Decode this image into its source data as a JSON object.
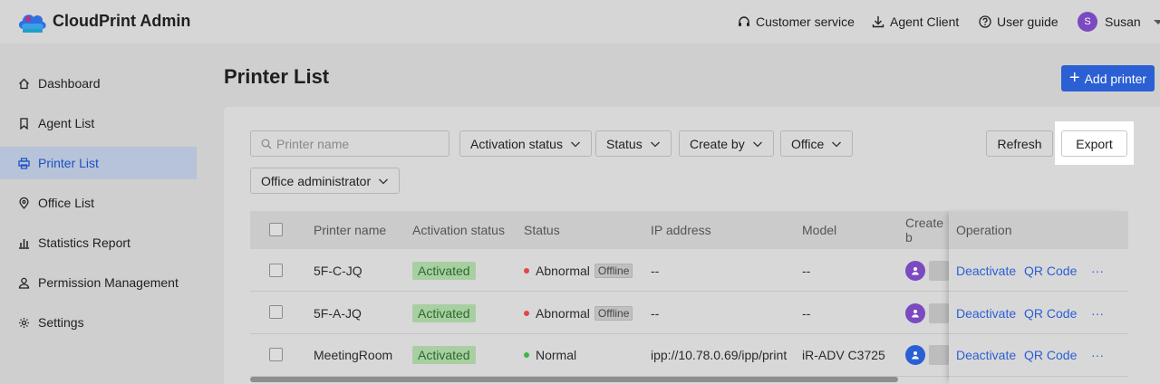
{
  "header": {
    "brand": "CloudPrint Admin",
    "customer_service": "Customer service",
    "agent_client": "Agent Client",
    "user_guide": "User guide",
    "user_initial": "S",
    "user_name": "Susan"
  },
  "sidebar": {
    "items": [
      {
        "label": "Dashboard",
        "icon": "home-icon"
      },
      {
        "label": "Agent List",
        "icon": "bookmark-icon"
      },
      {
        "label": "Printer List",
        "icon": "printer-icon",
        "active": true
      },
      {
        "label": "Office List",
        "icon": "location-icon"
      },
      {
        "label": "Statistics Report",
        "icon": "bar-chart-icon"
      },
      {
        "label": "Permission Management",
        "icon": "user-icon"
      },
      {
        "label": "Settings",
        "icon": "gear-icon"
      }
    ]
  },
  "main": {
    "title": "Printer List",
    "add_button": "Add printer",
    "search_placeholder": "Printer name",
    "filters": {
      "activation_status": "Activation status",
      "status": "Status",
      "create_by": "Create by",
      "office": "Office",
      "office_administrator": "Office administrator"
    },
    "refresh_button": "Refresh",
    "export_button": "Export"
  },
  "table": {
    "columns": {
      "printer_name": "Printer name",
      "activation_status": "Activation status",
      "status": "Status",
      "ip_address": "IP address",
      "model": "Model",
      "create_by": "Create b",
      "operation": "Operation"
    },
    "rows": [
      {
        "name": "5F-C-JQ",
        "activation": "Activated",
        "status": "Abnormal",
        "status_tag": "Offline",
        "ip": "--",
        "model": "--",
        "deactivate": "Deactivate",
        "qr": "QR Code",
        "more": "···"
      },
      {
        "name": "5F-A-JQ",
        "activation": "Activated",
        "status": "Abnormal",
        "status_tag": "Offline",
        "ip": "--",
        "model": "--",
        "deactivate": "Deactivate",
        "qr": "QR Code",
        "more": "···"
      },
      {
        "name": "MeetingRoom",
        "activation": "Activated",
        "status": "Normal",
        "ip": "ipp://10.78.0.69/ipp/print",
        "model": "iR-ADV C3725",
        "deactivate": "Deactivate",
        "qr": "QR Code",
        "more": "···"
      }
    ]
  },
  "colors": {
    "accent": "#2b5fd4",
    "abnormal": "#e04848",
    "normal": "#3bb54a",
    "avatar_purple": "#7b4ac0",
    "avatar_blue": "#2b5fd4"
  }
}
